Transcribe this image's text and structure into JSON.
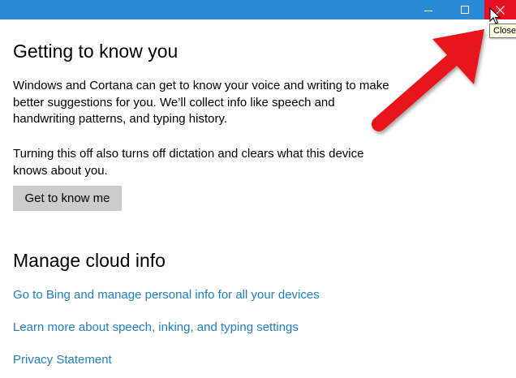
{
  "window": {
    "close_tooltip": "Close",
    "titlebar_color": "#2b8ad6",
    "close_button_color": "#e81123",
    "buttons": [
      "minimize-icon",
      "maximize-icon",
      "close-icon"
    ]
  },
  "section_know_you": {
    "heading": "Getting to know you",
    "paragraph1": "Windows and Cortana can get to know your voice and writing to make better suggestions for you. We’ll collect info like speech and handwriting patterns, and typing history.",
    "paragraph2": "Turning this off also turns off dictation and clears what this device knows about you.",
    "button_label": "Get to know me"
  },
  "section_cloud": {
    "heading": "Manage cloud info",
    "links": [
      "Go to Bing and manage personal info for all your devices",
      "Learn more about speech, inking, and typing settings",
      "Privacy Statement"
    ]
  },
  "annotation": {
    "arrow_color": "#e8141e",
    "icon": "red-arrow-icon"
  },
  "link_color": "#1d7fc4"
}
